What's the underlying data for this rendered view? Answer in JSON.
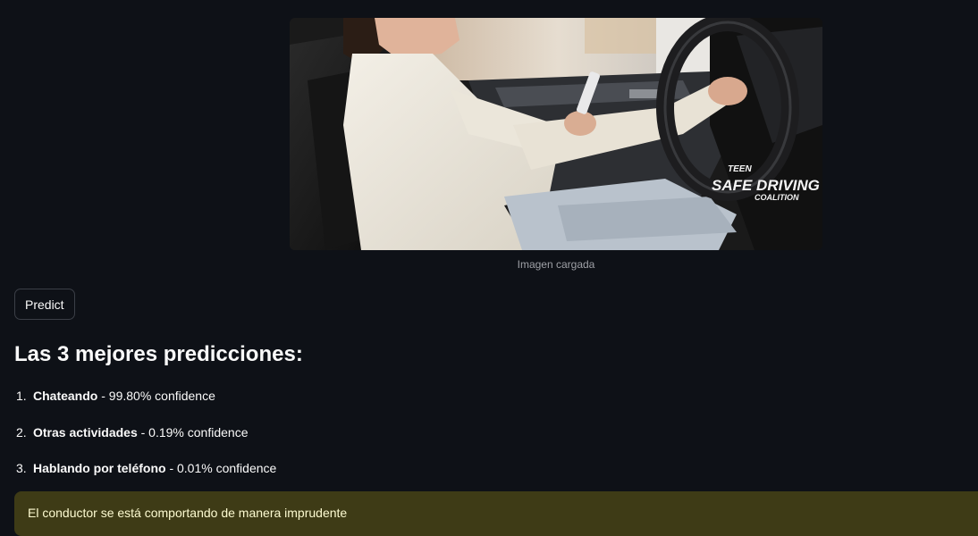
{
  "image": {
    "caption": "Imagen cargada",
    "watermark": {
      "line1": "TEEN",
      "line2": "SAFE DRIVING",
      "line3": "COALITION"
    }
  },
  "predict_button": {
    "label": "Predict"
  },
  "results": {
    "heading": "Las 3 mejores predicciones:",
    "predictions": [
      {
        "number": "1.",
        "label": "Chateando",
        "detail": " - 99.80% confidence"
      },
      {
        "number": "2.",
        "label": "Otras actividades",
        "detail": " - 0.19% confidence"
      },
      {
        "number": "3.",
        "label": "Hablando por teléfono",
        "detail": " - 0.01% confidence"
      }
    ]
  },
  "alert": {
    "message": "El conductor se está comportando de manera imprudente"
  },
  "colors": {
    "background": "#0e1117",
    "alert_background": "#3e3b16",
    "alert_text": "#fdfbd1"
  }
}
